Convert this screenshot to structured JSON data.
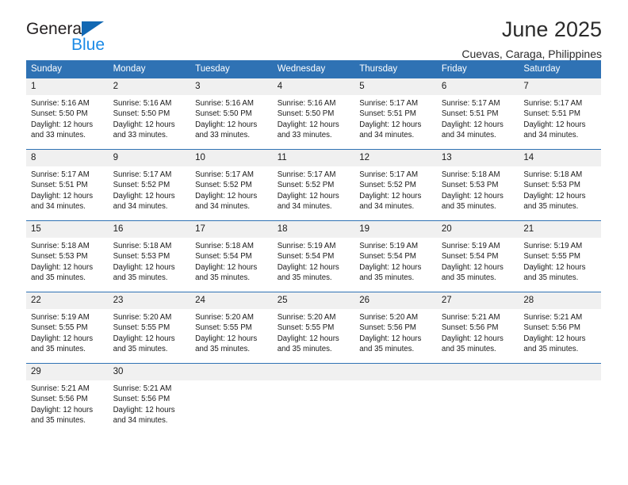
{
  "logo": {
    "primary_text": "General",
    "secondary_text": "Blue",
    "primary_color": "#231f20",
    "secondary_color": "#1b8ae6",
    "triangle_color": "#1268b3",
    "icon": "triangle-icon"
  },
  "header": {
    "month_title": "June 2025",
    "location": "Cuevas, Caraga, Philippines"
  },
  "theme": {
    "header_bg": "#2f72b4",
    "header_text": "#ffffff",
    "daynum_bg": "#f0f0f0",
    "row_divider": "#2f72b4",
    "body_text": "#1a1a1a"
  },
  "calendar": {
    "weekday_headers": [
      "Sunday",
      "Monday",
      "Tuesday",
      "Wednesday",
      "Thursday",
      "Friday",
      "Saturday"
    ],
    "weeks": [
      [
        {
          "day": "1",
          "sunrise": "Sunrise: 5:16 AM",
          "sunset": "Sunset: 5:50 PM",
          "daylight_line1": "Daylight: 12 hours",
          "daylight_line2": "and 33 minutes."
        },
        {
          "day": "2",
          "sunrise": "Sunrise: 5:16 AM",
          "sunset": "Sunset: 5:50 PM",
          "daylight_line1": "Daylight: 12 hours",
          "daylight_line2": "and 33 minutes."
        },
        {
          "day": "3",
          "sunrise": "Sunrise: 5:16 AM",
          "sunset": "Sunset: 5:50 PM",
          "daylight_line1": "Daylight: 12 hours",
          "daylight_line2": "and 33 minutes."
        },
        {
          "day": "4",
          "sunrise": "Sunrise: 5:16 AM",
          "sunset": "Sunset: 5:50 PM",
          "daylight_line1": "Daylight: 12 hours",
          "daylight_line2": "and 33 minutes."
        },
        {
          "day": "5",
          "sunrise": "Sunrise: 5:17 AM",
          "sunset": "Sunset: 5:51 PM",
          "daylight_line1": "Daylight: 12 hours",
          "daylight_line2": "and 34 minutes."
        },
        {
          "day": "6",
          "sunrise": "Sunrise: 5:17 AM",
          "sunset": "Sunset: 5:51 PM",
          "daylight_line1": "Daylight: 12 hours",
          "daylight_line2": "and 34 minutes."
        },
        {
          "day": "7",
          "sunrise": "Sunrise: 5:17 AM",
          "sunset": "Sunset: 5:51 PM",
          "daylight_line1": "Daylight: 12 hours",
          "daylight_line2": "and 34 minutes."
        }
      ],
      [
        {
          "day": "8",
          "sunrise": "Sunrise: 5:17 AM",
          "sunset": "Sunset: 5:51 PM",
          "daylight_line1": "Daylight: 12 hours",
          "daylight_line2": "and 34 minutes."
        },
        {
          "day": "9",
          "sunrise": "Sunrise: 5:17 AM",
          "sunset": "Sunset: 5:52 PM",
          "daylight_line1": "Daylight: 12 hours",
          "daylight_line2": "and 34 minutes."
        },
        {
          "day": "10",
          "sunrise": "Sunrise: 5:17 AM",
          "sunset": "Sunset: 5:52 PM",
          "daylight_line1": "Daylight: 12 hours",
          "daylight_line2": "and 34 minutes."
        },
        {
          "day": "11",
          "sunrise": "Sunrise: 5:17 AM",
          "sunset": "Sunset: 5:52 PM",
          "daylight_line1": "Daylight: 12 hours",
          "daylight_line2": "and 34 minutes."
        },
        {
          "day": "12",
          "sunrise": "Sunrise: 5:17 AM",
          "sunset": "Sunset: 5:52 PM",
          "daylight_line1": "Daylight: 12 hours",
          "daylight_line2": "and 34 minutes."
        },
        {
          "day": "13",
          "sunrise": "Sunrise: 5:18 AM",
          "sunset": "Sunset: 5:53 PM",
          "daylight_line1": "Daylight: 12 hours",
          "daylight_line2": "and 35 minutes."
        },
        {
          "day": "14",
          "sunrise": "Sunrise: 5:18 AM",
          "sunset": "Sunset: 5:53 PM",
          "daylight_line1": "Daylight: 12 hours",
          "daylight_line2": "and 35 minutes."
        }
      ],
      [
        {
          "day": "15",
          "sunrise": "Sunrise: 5:18 AM",
          "sunset": "Sunset: 5:53 PM",
          "daylight_line1": "Daylight: 12 hours",
          "daylight_line2": "and 35 minutes."
        },
        {
          "day": "16",
          "sunrise": "Sunrise: 5:18 AM",
          "sunset": "Sunset: 5:53 PM",
          "daylight_line1": "Daylight: 12 hours",
          "daylight_line2": "and 35 minutes."
        },
        {
          "day": "17",
          "sunrise": "Sunrise: 5:18 AM",
          "sunset": "Sunset: 5:54 PM",
          "daylight_line1": "Daylight: 12 hours",
          "daylight_line2": "and 35 minutes."
        },
        {
          "day": "18",
          "sunrise": "Sunrise: 5:19 AM",
          "sunset": "Sunset: 5:54 PM",
          "daylight_line1": "Daylight: 12 hours",
          "daylight_line2": "and 35 minutes."
        },
        {
          "day": "19",
          "sunrise": "Sunrise: 5:19 AM",
          "sunset": "Sunset: 5:54 PM",
          "daylight_line1": "Daylight: 12 hours",
          "daylight_line2": "and 35 minutes."
        },
        {
          "day": "20",
          "sunrise": "Sunrise: 5:19 AM",
          "sunset": "Sunset: 5:54 PM",
          "daylight_line1": "Daylight: 12 hours",
          "daylight_line2": "and 35 minutes."
        },
        {
          "day": "21",
          "sunrise": "Sunrise: 5:19 AM",
          "sunset": "Sunset: 5:55 PM",
          "daylight_line1": "Daylight: 12 hours",
          "daylight_line2": "and 35 minutes."
        }
      ],
      [
        {
          "day": "22",
          "sunrise": "Sunrise: 5:19 AM",
          "sunset": "Sunset: 5:55 PM",
          "daylight_line1": "Daylight: 12 hours",
          "daylight_line2": "and 35 minutes."
        },
        {
          "day": "23",
          "sunrise": "Sunrise: 5:20 AM",
          "sunset": "Sunset: 5:55 PM",
          "daylight_line1": "Daylight: 12 hours",
          "daylight_line2": "and 35 minutes."
        },
        {
          "day": "24",
          "sunrise": "Sunrise: 5:20 AM",
          "sunset": "Sunset: 5:55 PM",
          "daylight_line1": "Daylight: 12 hours",
          "daylight_line2": "and 35 minutes."
        },
        {
          "day": "25",
          "sunrise": "Sunrise: 5:20 AM",
          "sunset": "Sunset: 5:55 PM",
          "daylight_line1": "Daylight: 12 hours",
          "daylight_line2": "and 35 minutes."
        },
        {
          "day": "26",
          "sunrise": "Sunrise: 5:20 AM",
          "sunset": "Sunset: 5:56 PM",
          "daylight_line1": "Daylight: 12 hours",
          "daylight_line2": "and 35 minutes."
        },
        {
          "day": "27",
          "sunrise": "Sunrise: 5:21 AM",
          "sunset": "Sunset: 5:56 PM",
          "daylight_line1": "Daylight: 12 hours",
          "daylight_line2": "and 35 minutes."
        },
        {
          "day": "28",
          "sunrise": "Sunrise: 5:21 AM",
          "sunset": "Sunset: 5:56 PM",
          "daylight_line1": "Daylight: 12 hours",
          "daylight_line2": "and 35 minutes."
        }
      ],
      [
        {
          "day": "29",
          "sunrise": "Sunrise: 5:21 AM",
          "sunset": "Sunset: 5:56 PM",
          "daylight_line1": "Daylight: 12 hours",
          "daylight_line2": "and 35 minutes."
        },
        {
          "day": "30",
          "sunrise": "Sunrise: 5:21 AM",
          "sunset": "Sunset: 5:56 PM",
          "daylight_line1": "Daylight: 12 hours",
          "daylight_line2": "and 34 minutes."
        },
        {
          "day": "",
          "sunrise": "",
          "sunset": "",
          "daylight_line1": "",
          "daylight_line2": ""
        },
        {
          "day": "",
          "sunrise": "",
          "sunset": "",
          "daylight_line1": "",
          "daylight_line2": ""
        },
        {
          "day": "",
          "sunrise": "",
          "sunset": "",
          "daylight_line1": "",
          "daylight_line2": ""
        },
        {
          "day": "",
          "sunrise": "",
          "sunset": "",
          "daylight_line1": "",
          "daylight_line2": ""
        },
        {
          "day": "",
          "sunrise": "",
          "sunset": "",
          "daylight_line1": "",
          "daylight_line2": ""
        }
      ]
    ]
  }
}
